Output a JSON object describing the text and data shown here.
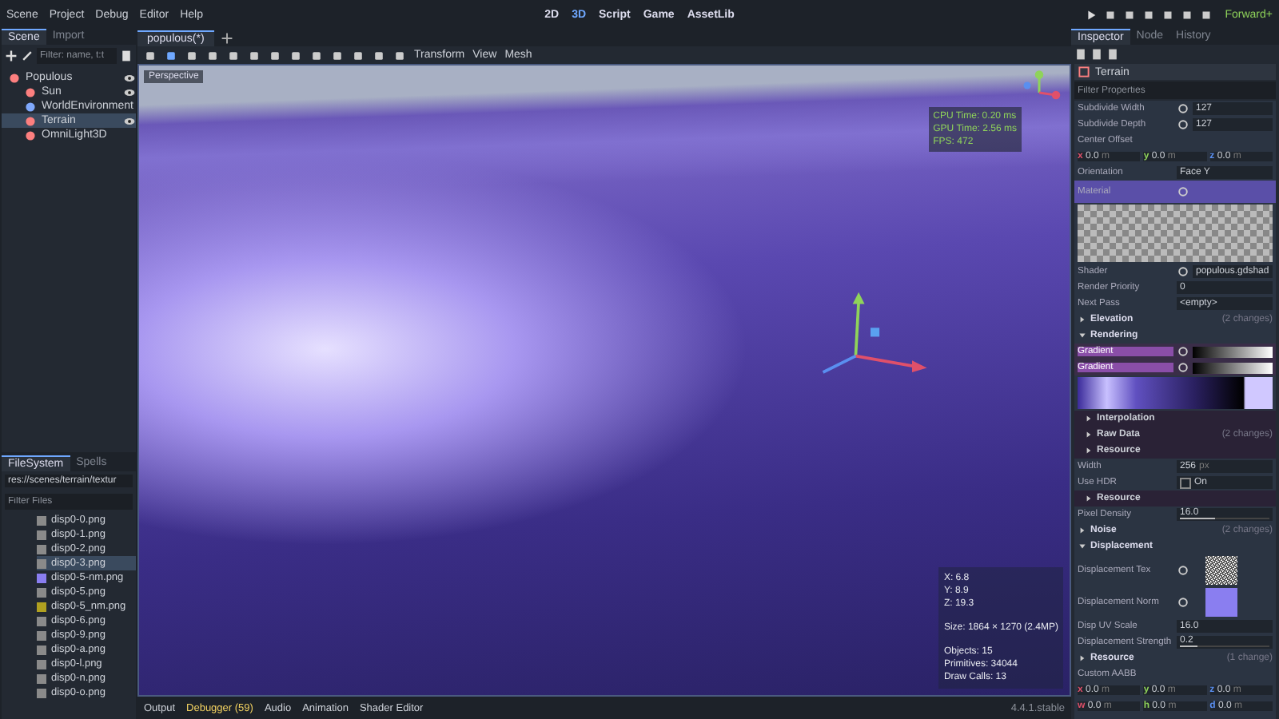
{
  "menu": [
    "Scene",
    "Project",
    "Debug",
    "Editor",
    "Help"
  ],
  "workspaces": [
    {
      "label": "2D",
      "selected": false
    },
    {
      "label": "3D",
      "selected": true
    },
    {
      "label": "Script",
      "selected": false
    },
    {
      "label": "Game",
      "selected": false
    },
    {
      "label": "AssetLib",
      "selected": false
    }
  ],
  "renderer": "Forward+",
  "scene_dock": {
    "tabs": [
      {
        "label": "Scene",
        "selected": true
      },
      {
        "label": "Import",
        "selected": false
      }
    ],
    "filter": {
      "placeholder": "Filter: name, t:t"
    },
    "tree": [
      {
        "name": "Populous",
        "color": "#fc7f7f",
        "selected": false,
        "visible_icon": true,
        "children": [
          {
            "name": "Sun",
            "color": "#fc7f7f",
            "selected": false,
            "visible_icon": true
          },
          {
            "name": "WorldEnvironment",
            "color": "#7fa8fc",
            "selected": false,
            "visible_icon": false
          },
          {
            "name": "Terrain",
            "color": "#fc7f7f",
            "selected": true,
            "visible_icon": true
          },
          {
            "name": "OmniLight3D",
            "color": "#fc7f7f",
            "selected": false,
            "visible_icon": false
          }
        ]
      }
    ]
  },
  "filesystem": {
    "tabs": [
      {
        "label": "FileSystem",
        "selected": true
      },
      {
        "label": "Spells",
        "selected": false
      }
    ],
    "path": "res://scenes/terrain/textur",
    "filter": {
      "placeholder": "Filter Files"
    },
    "files": [
      {
        "name": "disp0-0.png",
        "selected": false,
        "color": "#8a8a8a"
      },
      {
        "name": "disp0-1.png",
        "selected": false,
        "color": "#8a8a8a"
      },
      {
        "name": "disp0-2.png",
        "selected": false,
        "color": "#8a8a8a"
      },
      {
        "name": "disp0-3.png",
        "selected": true,
        "color": "#8a8a8a"
      },
      {
        "name": "disp0-5-nm.png",
        "selected": false,
        "color": "#8a7ef0"
      },
      {
        "name": "disp0-5.png",
        "selected": false,
        "color": "#8a8a8a"
      },
      {
        "name": "disp0-5_nm.png",
        "selected": false,
        "color": "#b0a020"
      },
      {
        "name": "disp0-6.png",
        "selected": false,
        "color": "#8a8a8a"
      },
      {
        "name": "disp0-9.png",
        "selected": false,
        "color": "#8a8a8a"
      },
      {
        "name": "disp0-a.png",
        "selected": false,
        "color": "#8a8a8a"
      },
      {
        "name": "disp0-l.png",
        "selected": false,
        "color": "#8a8a8a"
      },
      {
        "name": "disp0-n.png",
        "selected": false,
        "color": "#8a8a8a"
      },
      {
        "name": "disp0-o.png",
        "selected": false,
        "color": "#8a8a8a"
      }
    ]
  },
  "editor_tabs": [
    {
      "label": "populous(*)",
      "selected": true
    }
  ],
  "viewport_menus": [
    "Transform",
    "View",
    "Mesh"
  ],
  "viewport": {
    "view_button": "Perspective",
    "perf": [
      "CPU Time: 0.20 ms",
      "GPU Time: 2.56 ms",
      "FPS: 472"
    ],
    "info": [
      [
        "X: 6.8",
        "Y: 8.9",
        "Z: 19.3"
      ],
      [
        "Size: 1864 × 1270 (2.4MP)"
      ],
      [
        "Objects: 15",
        "Primitives: 34044",
        "Draw Calls: 13"
      ]
    ]
  },
  "bottom_panel": {
    "tabs": [
      {
        "label": "Output",
        "alert": false
      },
      {
        "label": "Debugger (59)",
        "alert": true
      },
      {
        "label": "Audio",
        "alert": false
      },
      {
        "label": "Animation",
        "alert": false
      },
      {
        "label": "Shader Editor",
        "alert": false
      }
    ],
    "version": "4.4.1.stable"
  },
  "inspector": {
    "tabs": [
      {
        "label": "Inspector",
        "selected": true
      },
      {
        "label": "Node",
        "selected": false
      },
      {
        "label": "History",
        "selected": false
      }
    ],
    "node": "Terrain",
    "filter": {
      "placeholder": "Filter Properties"
    },
    "rows": [
      {
        "kind": "number",
        "label": "Subdivide Width",
        "value": "127",
        "revert": true
      },
      {
        "kind": "number",
        "label": "Subdivide Depth",
        "value": "127",
        "revert": true
      },
      {
        "kind": "label",
        "label": "Center Offset"
      },
      {
        "kind": "vector",
        "fields": [
          {
            "axis": "x",
            "value": "0.0",
            "unit": "m"
          },
          {
            "axis": "y",
            "value": "0.0",
            "unit": "m"
          },
          {
            "axis": "z",
            "value": "0.0",
            "unit": "m"
          }
        ]
      },
      {
        "kind": "dropdown",
        "label": "Orientation",
        "value": "Face Y"
      },
      {
        "kind": "material",
        "label": "Material",
        "revert": true
      },
      {
        "kind": "preview"
      },
      {
        "kind": "resource",
        "label": "Shader",
        "value": "populous.gdshad",
        "revert": true
      },
      {
        "kind": "number",
        "label": "Render Priority",
        "value": "0"
      },
      {
        "kind": "dropdown",
        "label": "Next Pass",
        "value": "<empty>"
      },
      {
        "kind": "section",
        "label": "Elevation",
        "expanded": false,
        "note": "(2 changes)"
      },
      {
        "kind": "section",
        "label": "Rendering",
        "expanded": true,
        "note": ""
      },
      {
        "kind": "gradient",
        "label": "Gradient",
        "revert": true
      },
      {
        "kind": "gradient",
        "label": "Gradient",
        "revert": true
      },
      {
        "kind": "gradient-editor"
      },
      {
        "kind": "subsection",
        "label": "Interpolation",
        "note": ""
      },
      {
        "kind": "subsection",
        "label": "Raw Data",
        "note": "(2 changes)"
      },
      {
        "kind": "subsection",
        "label": "Resource",
        "note": ""
      },
      {
        "kind": "number",
        "label": "Width",
        "value": "256",
        "unit": "px"
      },
      {
        "kind": "check",
        "label": "Use HDR",
        "value": "On",
        "checked": false
      },
      {
        "kind": "subsection",
        "label": "Resource",
        "note": ""
      },
      {
        "kind": "slider",
        "label": "Pixel Density",
        "value": "16.0",
        "level": 0.4
      },
      {
        "kind": "section",
        "label": "Noise",
        "expanded": false,
        "note": "(2 changes)"
      },
      {
        "kind": "section",
        "label": "Displacement",
        "expanded": true,
        "note": ""
      },
      {
        "kind": "noisetexture",
        "label": "Displacement Tex",
        "revert": true
      },
      {
        "kind": "normaltexture",
        "label": "Displacement Norm",
        "revert": true
      },
      {
        "kind": "number",
        "label": "Disp UV Scale",
        "value": "16.0"
      },
      {
        "kind": "slider",
        "label": "Displacement Strength",
        "value": "0.2",
        "level": 0.2
      },
      {
        "kind": "section",
        "label": "Resource",
        "expanded": false,
        "note": "(1 change)"
      },
      {
        "kind": "label",
        "label": "Custom AABB"
      },
      {
        "kind": "vector",
        "fields": [
          {
            "axis": "x",
            "value": "0.0",
            "unit": "m"
          },
          {
            "axis": "y",
            "value": "0.0",
            "unit": "m"
          },
          {
            "axis": "z",
            "value": "0.0",
            "unit": "m"
          }
        ]
      },
      {
        "kind": "vector",
        "fields": [
          {
            "axis": "w",
            "value": "0.0",
            "unit": "m"
          },
          {
            "axis": "h",
            "value": "0.0",
            "unit": "m"
          },
          {
            "axis": "d",
            "value": "0.0",
            "unit": "m"
          }
        ]
      }
    ]
  }
}
